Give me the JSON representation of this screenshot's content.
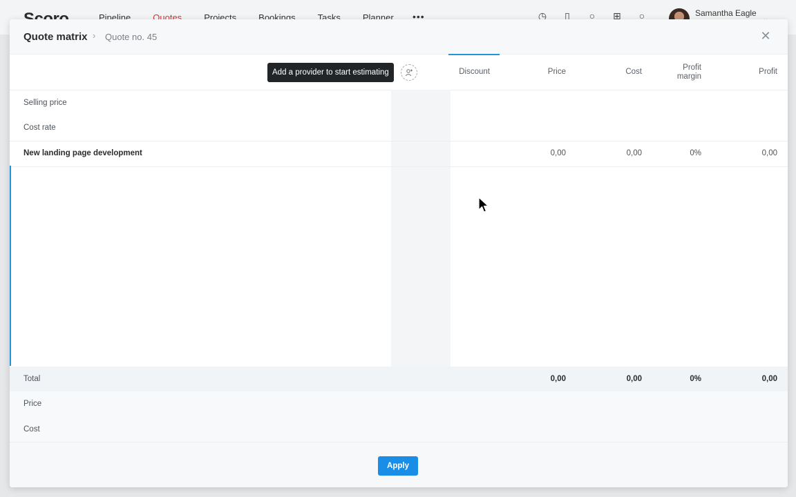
{
  "app": {
    "logo": "Scoro",
    "nav": [
      "Pipeline",
      "Quotes",
      "Projects",
      "Bookings",
      "Tasks",
      "Planner"
    ],
    "active_nav": "Quotes",
    "more_label": "•••",
    "user_name": "Samantha Eagle"
  },
  "modal": {
    "title": "Quote matrix",
    "breadcrumb_sep": "›",
    "breadcrumb": "Quote no. 45",
    "close_label": "✕"
  },
  "header": {
    "tooltip": "Add a provider to start estimating",
    "columns": {
      "discount": "Discount",
      "price": "Price",
      "cost": "Cost",
      "profit_margin_1": "Profit",
      "profit_margin_2": "margin",
      "profit": "Profit"
    }
  },
  "rows": {
    "selling_price": "Selling price",
    "cost_rate": "Cost rate",
    "line_item": {
      "label": "New landing page development",
      "price": "0,00",
      "cost": "0,00",
      "margin": "0%",
      "profit": "0,00"
    }
  },
  "totals": {
    "label": "Total",
    "price": "0,00",
    "cost": "0,00",
    "margin": "0%",
    "profit": "0,00",
    "price_label": "Price",
    "cost_label": "Cost"
  },
  "footer": {
    "apply_label": "Apply"
  },
  "colors": {
    "accent": "#1a8ee6",
    "brand": "#d0343a"
  }
}
